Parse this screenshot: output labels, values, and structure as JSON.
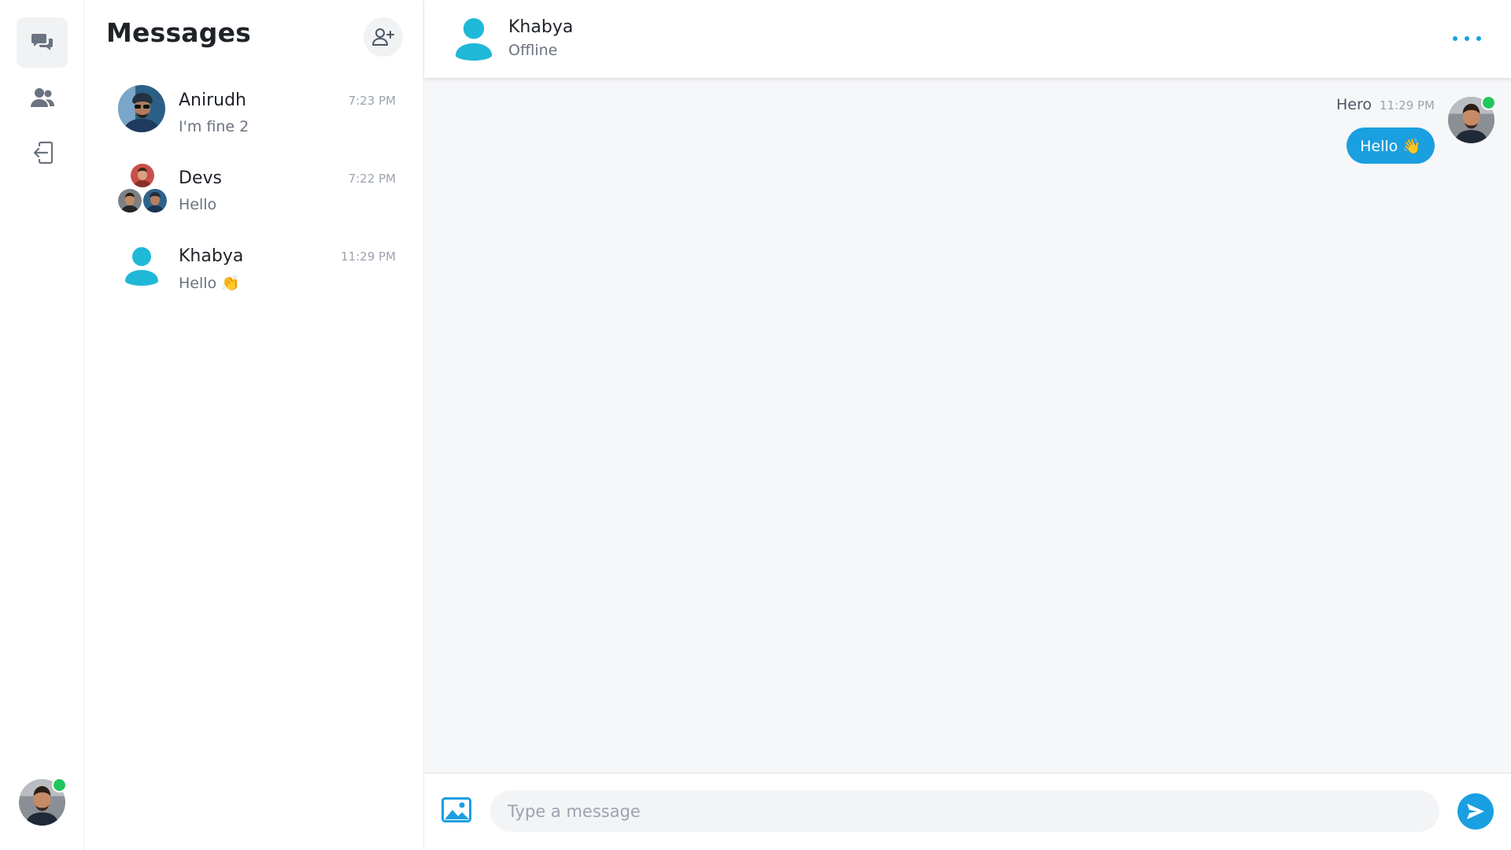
{
  "rail": {
    "items": [
      {
        "icon": "chat-bubbles-icon",
        "active": true
      },
      {
        "icon": "users-icon",
        "active": false
      },
      {
        "icon": "logout-icon",
        "active": false
      }
    ],
    "user_online": true
  },
  "list": {
    "title": "Messages",
    "add_icon": "user-plus-icon",
    "conversations": [
      {
        "name": "Anirudh",
        "preview": "I'm fine 2",
        "time": "7:23 PM",
        "avatar": "photo"
      },
      {
        "name": "Devs",
        "preview": "Hello",
        "time": "7:22 PM",
        "avatar": "group"
      },
      {
        "name": "Khabya",
        "preview": "Hello 👏",
        "time": "11:29 PM",
        "avatar": "placeholder-person"
      }
    ]
  },
  "chat": {
    "peer_name": "Khabya",
    "peer_status": "Offline",
    "more_icon": "ellipsis-icon",
    "messages": [
      {
        "sender": "Hero",
        "time": "11:29 PM",
        "text": "Hello 👋",
        "online": true
      }
    ]
  },
  "composer": {
    "placeholder": "Type a message",
    "attach_icon": "image-icon",
    "send_icon": "send-icon"
  },
  "colors": {
    "accent": "#1a9fe0",
    "placeholder_avatar": "#20b8d8",
    "online": "#22c55e",
    "rail_icon": "#6b7280"
  }
}
